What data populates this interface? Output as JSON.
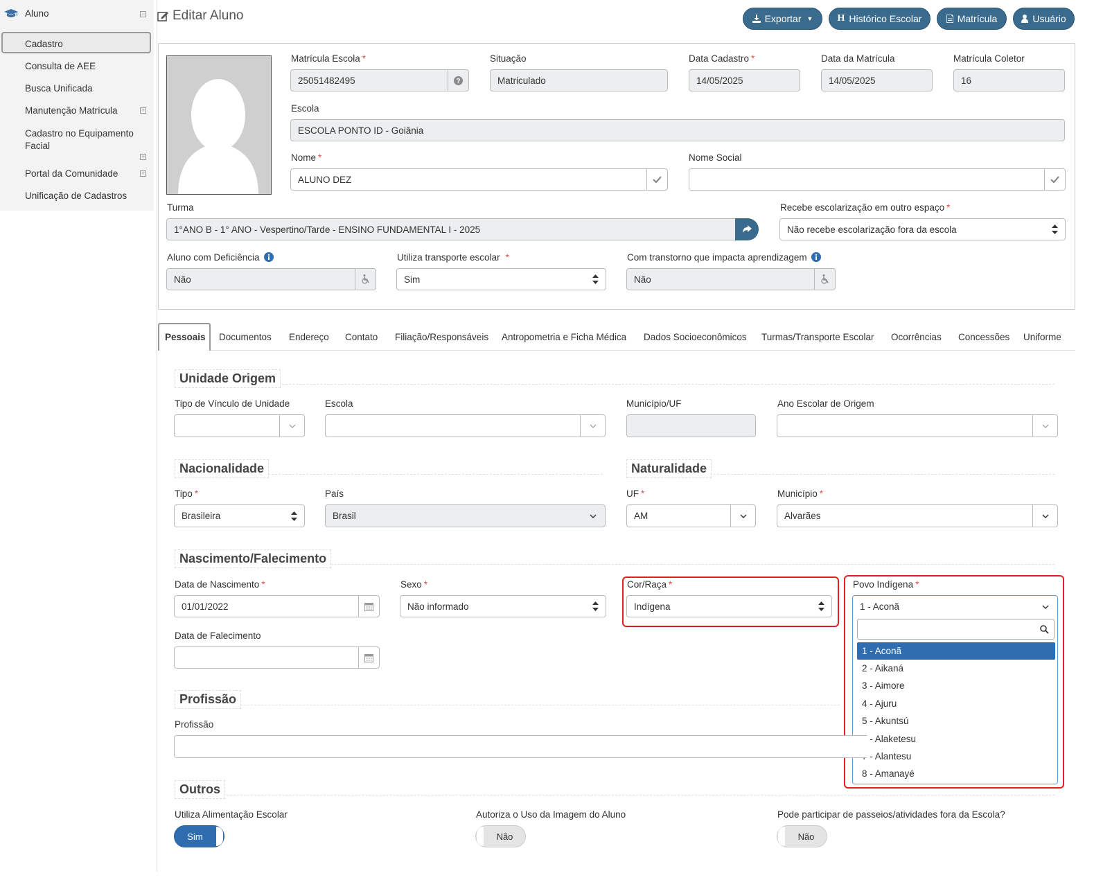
{
  "sidebar": {
    "title": "Aluno",
    "items": [
      {
        "label": "Cadastro"
      },
      {
        "label": "Consulta de AEE"
      },
      {
        "label": "Busca Unificada"
      },
      {
        "label": "Manutenção Matrícula"
      },
      {
        "label": "Cadastro no Equipamento Facial"
      },
      {
        "label": "Portal da Comunidade"
      },
      {
        "label": "Unificação de Cadastros"
      }
    ]
  },
  "header": {
    "title": "Editar Aluno",
    "buttons": {
      "exportar": "Exportar",
      "historico": "Histórico Escolar",
      "matricula": "Matrícula",
      "usuario": "Usuário"
    },
    "accent": "#3a6a8c"
  },
  "student": {
    "matricula_escola": {
      "label": "Matrícula Escola",
      "value": "25051482495"
    },
    "situacao": {
      "label": "Situação",
      "value": "Matriculado"
    },
    "data_cadastro": {
      "label": "Data Cadastro",
      "value": "14/05/2025"
    },
    "data_matricula": {
      "label": "Data da Matrícula",
      "value": "14/05/2025"
    },
    "matricula_coletor": {
      "label": "Matrícula Coletor",
      "value": "16"
    },
    "escola": {
      "label": "Escola",
      "value": "ESCOLA PONTO ID - Goiânia"
    },
    "nome": {
      "label": "Nome",
      "value": "ALUNO DEZ"
    },
    "nome_social": {
      "label": "Nome Social",
      "value": ""
    },
    "turma": {
      "label": "Turma",
      "value": "1°ANO B - 1° ANO - Vespertino/Tarde - ENSINO FUNDAMENTAL I - 2025"
    },
    "escolarizacao": {
      "label": "Recebe escolarização em outro espaço",
      "value": "Não recebe escolarização fora da escola"
    },
    "deficiencia": {
      "label": "Aluno com Deficiência",
      "value": "Não"
    },
    "transporte": {
      "label": "Utiliza transporte escolar",
      "value": "Sim"
    },
    "transtorno": {
      "label": "Com transtorno que impacta aprendizagem",
      "value": "Não"
    }
  },
  "tabs": [
    {
      "label": "Pessoais"
    },
    {
      "label": "Documentos"
    },
    {
      "label": "Endereço"
    },
    {
      "label": "Contato"
    },
    {
      "label": "Filiação/Responsáveis"
    },
    {
      "label": "Antropometria e Ficha Médica"
    },
    {
      "label": "Dados Socioeconômicos"
    },
    {
      "label": "Turmas/Transporte Escolar"
    },
    {
      "label": "Ocorrências"
    },
    {
      "label": "Concessões"
    },
    {
      "label": "Uniforme"
    }
  ],
  "unidade_origem": {
    "title": "Unidade Origem",
    "tipo_vinculo": {
      "label": "Tipo de Vínculo de Unidade",
      "value": ""
    },
    "escola": {
      "label": "Escola",
      "value": ""
    },
    "municipio_uf": {
      "label": "Município/UF",
      "value": ""
    },
    "ano_escolar": {
      "label": "Ano Escolar de Origem",
      "value": ""
    }
  },
  "nacionalidade": {
    "title": "Nacionalidade",
    "tipo": {
      "label": "Tipo",
      "value": "Brasileira"
    },
    "pais": {
      "label": "País",
      "value": "Brasil"
    }
  },
  "naturalidade": {
    "title": "Naturalidade",
    "uf": {
      "label": "UF",
      "value": "AM"
    },
    "municipio": {
      "label": "Município",
      "value": "Alvarães"
    }
  },
  "nascimento": {
    "title": "Nascimento/Falecimento",
    "data_nascimento": {
      "label": "Data de Nascimento",
      "value": "01/01/2022"
    },
    "sexo": {
      "label": "Sexo",
      "value": "Não informado"
    },
    "cor_raca": {
      "label": "Cor/Raça",
      "value": "Indígena"
    },
    "povo_indigena": {
      "label": "Povo Indígena",
      "value": "1 - Aconã"
    },
    "data_falecimento": {
      "label": "Data de Falecimento",
      "value": ""
    }
  },
  "povo_dropdown": {
    "search": "",
    "options": [
      "1 - Aconã",
      "2 - Aikaná",
      "3 - Aimore",
      "4 - Ajuru",
      "5 - Akuntsú",
      "6 - Alaketesu",
      "7 - Alantesu",
      "8 - Amanayé"
    ],
    "selected_index": 0,
    "highlight_color": "#2f6db0"
  },
  "profissao": {
    "title": "Profissão",
    "field": {
      "label": "Profissão",
      "value": ""
    }
  },
  "outros": {
    "title": "Outros",
    "alimentacao": {
      "label": "Utiliza Alimentação Escolar",
      "value": "Sim"
    },
    "imagem": {
      "label": "Autoriza o Uso da Imagem do Aluno",
      "value": "Não"
    },
    "passeios": {
      "label": "Pode participar de passeios/atividades fora da Escola?",
      "value": "Não"
    }
  },
  "highlight_color": "#e02020"
}
